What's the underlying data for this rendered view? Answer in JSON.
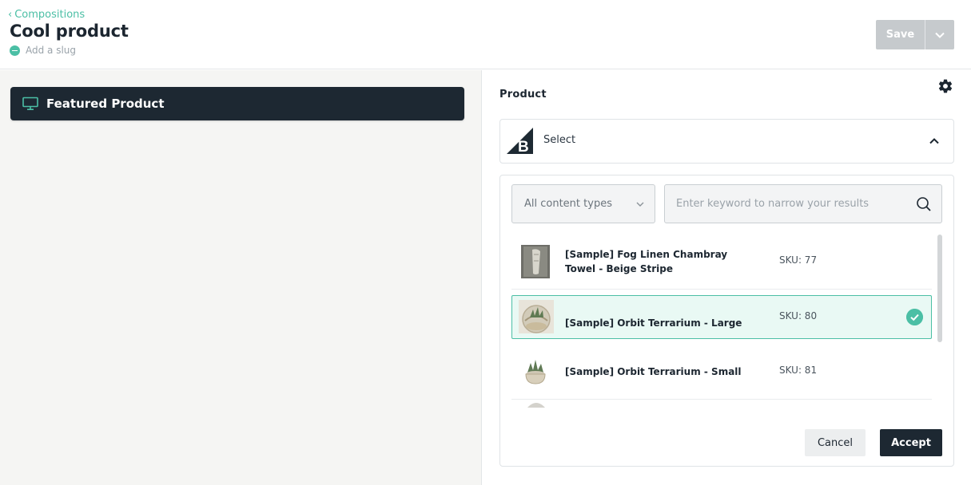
{
  "header": {
    "breadcrumb": "Compositions",
    "title": "Cool product",
    "slug_placeholder": "Add a slug",
    "save_label": "Save"
  },
  "canvas": {
    "component_label": "Featured Product"
  },
  "panel": {
    "label": "Product",
    "select_text": "Select",
    "content_type": "All content types",
    "search_placeholder": "Enter keyword to narrow your results",
    "items": [
      {
        "name": "[Sample] Fog Linen Chambray Towel - Beige Stripe",
        "sku": "SKU: 77",
        "selected": false
      },
      {
        "name": "[Sample] Orbit Terrarium - Large",
        "sku": "SKU: 80",
        "selected": true
      },
      {
        "name": "[Sample] Orbit Terrarium - Small",
        "sku": "SKU: 81",
        "selected": false
      }
    ],
    "cancel_label": "Cancel",
    "accept_label": "Accept"
  },
  "colors": {
    "accent": "#4bbfa5",
    "dark": "#1d2832",
    "selected_bg": "#e9f9f4",
    "save_disabled": "#c6cacd"
  },
  "icons": [
    "chevron-left-icon",
    "minus-circle-icon",
    "chevron-down-icon",
    "monitor-icon",
    "gear-icon",
    "bigcommerce-logo",
    "chevron-up-icon",
    "search-icon",
    "check-circle-icon"
  ]
}
